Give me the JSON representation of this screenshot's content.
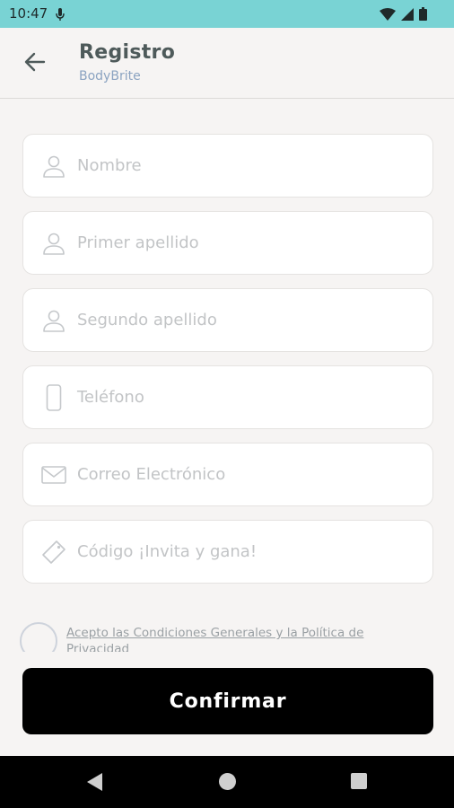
{
  "status_bar": {
    "time": "10:47",
    "mic_icon": "mic-icon",
    "wifi_icon": "wifi-icon",
    "signal_icon": "signal-icon",
    "battery_icon": "battery-icon",
    "background_color": "#79d3d4"
  },
  "header": {
    "back_icon": "arrow-left-icon",
    "title": "Registro",
    "subtitle": "BodyBrite"
  },
  "form": {
    "fields": [
      {
        "placeholder": "Nombre",
        "icon": "user-icon"
      },
      {
        "placeholder": "Primer apellido",
        "icon": "user-icon"
      },
      {
        "placeholder": "Segundo apellido",
        "icon": "user-icon"
      },
      {
        "placeholder": "Teléfono",
        "icon": "phone-icon"
      },
      {
        "placeholder": "Correo Electrónico",
        "icon": "mail-icon"
      },
      {
        "placeholder": "Código ¡Invita y gana!",
        "icon": "tag-icon"
      }
    ],
    "terms_text": "Acepto las Condiciones Generales y la Política de Privacidad",
    "terms_checked": false,
    "confirm_label": "Confirmar"
  },
  "nav_bar": {
    "back_icon": "triangle-back-icon",
    "home_icon": "circle-home-icon",
    "recent_icon": "square-recents-icon"
  },
  "colors": {
    "accent": "#79d3d4",
    "subtitle": "#8ba3c1",
    "button": "#000000",
    "background": "#f6f4f3"
  }
}
